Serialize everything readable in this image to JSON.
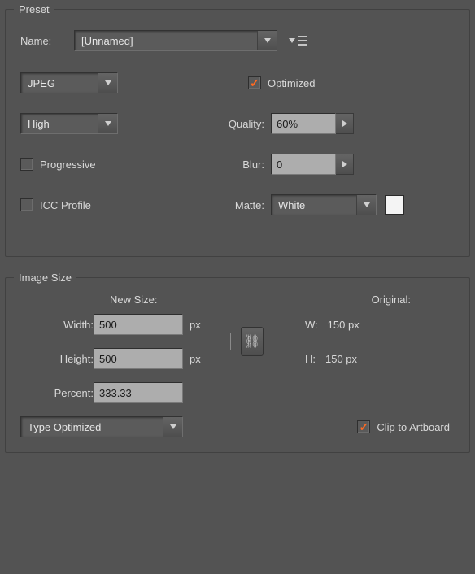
{
  "preset": {
    "legend": "Preset",
    "name_label": "Name:",
    "name_value": "[Unnamed]",
    "format": "JPEG",
    "optimized_label": "Optimized",
    "optimized_checked": true,
    "quality_preset": "High",
    "quality_label": "Quality:",
    "quality_value": "60%",
    "progressive_label": "Progressive",
    "progressive_checked": false,
    "blur_label": "Blur:",
    "blur_value": "0",
    "icc_label": "ICC Profile",
    "icc_checked": false,
    "matte_label": "Matte:",
    "matte_value": "White"
  },
  "image_size": {
    "legend": "Image Size",
    "new_size_label": "New Size:",
    "original_label": "Original:",
    "width_label": "Width:",
    "width_value": "500",
    "width_unit": "px",
    "height_label": "Height:",
    "height_value": "500",
    "height_unit": "px",
    "orig_w_label": "W:",
    "orig_w_value": "150 px",
    "orig_h_label": "H:",
    "orig_h_value": "150 px",
    "percent_label": "Percent:",
    "percent_value": "333.33",
    "resample": "Type Optimized",
    "clip_label": "Clip to Artboard",
    "clip_checked": true
  }
}
